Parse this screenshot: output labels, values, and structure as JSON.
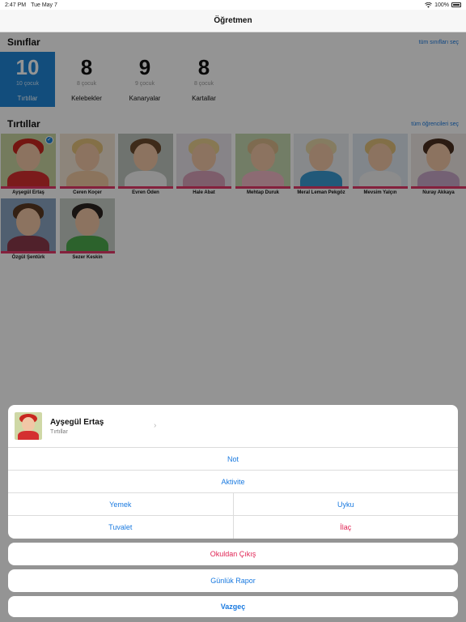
{
  "status_bar": {
    "time": "2:47 PM",
    "date": "Tue May 7",
    "battery": "100%"
  },
  "nav": {
    "title": "Öğretmen"
  },
  "classes_section": {
    "title": "Sınıflar",
    "link": "tüm sınıfları seç"
  },
  "classes": [
    {
      "count": "10",
      "sub": "10 çocuk",
      "name": "Tırtıllar",
      "active": true
    },
    {
      "count": "8",
      "sub": "8 çocuk",
      "name": "Kelebekler",
      "active": false
    },
    {
      "count": "9",
      "sub": "9 çocuk",
      "name": "Kanaryalar",
      "active": false
    },
    {
      "count": "8",
      "sub": "8 çocuk",
      "name": "Kartallar",
      "active": false
    }
  ],
  "students_section": {
    "title": "Tırtıllar",
    "link": "tüm öğrencileri seç"
  },
  "students": [
    {
      "name": "Ayşegül Ertaş",
      "selected": true,
      "bg": "#c9d4a1",
      "hair": "#c8261e",
      "shirt": "#d43030"
    },
    {
      "name": "Ceren Koçer",
      "bg": "#f3e6d4",
      "hair": "#e3c27a",
      "shirt": "#f0c9a0"
    },
    {
      "name": "Evren Öden",
      "bg": "#bfc6c0",
      "hair": "#6b4a2e",
      "shirt": "#f4f4f4"
    },
    {
      "name": "Hale Abat",
      "bg": "#e9e3ea",
      "hair": "#e8cf8f",
      "shirt": "#d8a0b8"
    },
    {
      "name": "Mehtap Duruk",
      "bg": "#c5d7b0",
      "hair": "#d9b98a",
      "shirt": "#f1b9c6"
    },
    {
      "name": "Meral Leman Pekgöz",
      "bg": "#e8ecef",
      "hair": "#e6d6a8",
      "shirt": "#3a9ad1"
    },
    {
      "name": "Mevsim Yalçın",
      "bg": "#dfe7f0",
      "hair": "#e1c07a",
      "shirt": "#f2f2f2"
    },
    {
      "name": "Nuray Akkaya",
      "bg": "#efe8e6",
      "hair": "#4a3020",
      "shirt": "#c8a8c8"
    },
    {
      "name": "Özgül Şentürk",
      "bg": "#8aa4c2",
      "hair": "#5a3a24",
      "shirt": "#8a3a4a"
    },
    {
      "name": "Sezer Keskin",
      "bg": "#c9cfc9",
      "hair": "#2a2420",
      "shirt": "#4caa4c"
    }
  ],
  "sheet": {
    "student_name": "Ayşegül Ertaş",
    "student_class": "Tırtıllar",
    "note": "Not",
    "activity": "Aktivite",
    "food": "Yemek",
    "sleep": "Uyku",
    "toilet": "Tuvalet",
    "medicine": "İlaç",
    "checkout": "Okuldan Çıkış",
    "daily_report": "Günlük Rapor",
    "cancel": "Vazgeç"
  },
  "colors": {
    "accent": "#1f86d6",
    "danger": "#e02454",
    "student_bar": "#e43a6a"
  }
}
